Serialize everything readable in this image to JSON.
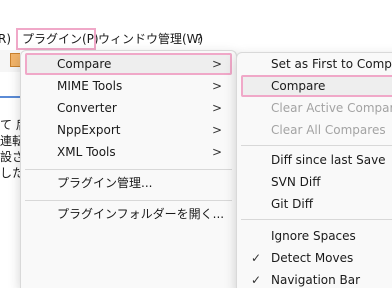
{
  "menubar": {
    "items": [
      {
        "label": "R)"
      },
      {
        "label": "プラグイン(P)"
      },
      {
        "label": "ウィンドウ管理(W)"
      },
      {
        "label": "?"
      }
    ]
  },
  "editor": {
    "lines": [
      "て 后",
      "連転",
      "設さ",
      "した"
    ]
  },
  "plugins_menu": {
    "items": [
      {
        "label": "Compare",
        "submenu": true
      },
      {
        "label": "MIME Tools",
        "submenu": true
      },
      {
        "label": "Converter",
        "submenu": true
      },
      {
        "label": "NppExport",
        "submenu": true
      },
      {
        "label": "XML Tools",
        "submenu": true
      },
      {
        "label": "プラグイン管理..."
      },
      {
        "label": "プラグインフォルダーを開く..."
      }
    ]
  },
  "compare_menu": {
    "items": [
      {
        "label": "Set as First to Compare"
      },
      {
        "label": "Compare"
      },
      {
        "label": "Clear Active Compare",
        "disabled": true
      },
      {
        "label": "Clear All Compares",
        "disabled": true
      },
      {
        "label": "Diff since last Save"
      },
      {
        "label": "SVN Diff"
      },
      {
        "label": "Git Diff"
      },
      {
        "label": "Ignore Spaces"
      },
      {
        "label": "Detect Moves",
        "checked": true
      },
      {
        "label": "Navigation Bar",
        "checked": true
      }
    ]
  },
  "glyphs": {
    "submenu_arrow": ">",
    "check": "✓"
  },
  "colors": {
    "highlight_outline": "#f0a8c8",
    "hover_bg": "#eeeeee",
    "disabled_text": "#a3a3a3"
  }
}
